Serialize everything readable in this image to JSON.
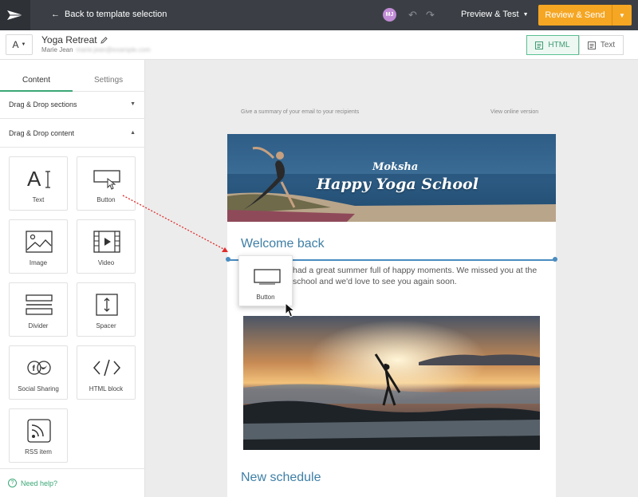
{
  "topbar": {
    "back_label": "Back to template selection",
    "avatar_initials": "MJ",
    "preview_label": "Preview & Test",
    "review_label": "Review & Send"
  },
  "subbar": {
    "font_label": "A",
    "campaign_name": "Yoga Retreat",
    "owner_name": "Marie Jean",
    "owner_email_hidden": "marie.jean@example.com",
    "view_html": "HTML",
    "view_text": "Text"
  },
  "left_panel": {
    "tabs": [
      "Content",
      "Settings"
    ],
    "active_tab": "Content",
    "sections": {
      "dd_sections": "Drag & Drop sections",
      "dd_content": "Drag & Drop content"
    },
    "tiles": [
      {
        "label": "Text",
        "icon": "text-icon"
      },
      {
        "label": "Button",
        "icon": "button-icon"
      },
      {
        "label": "Image",
        "icon": "image-icon"
      },
      {
        "label": "Video",
        "icon": "video-icon"
      },
      {
        "label": "Divider",
        "icon": "divider-icon"
      },
      {
        "label": "Spacer",
        "icon": "spacer-icon"
      },
      {
        "label": "Social Sharing",
        "icon": "social-sharing-icon"
      },
      {
        "label": "HTML block",
        "icon": "code-icon"
      },
      {
        "label": "RSS item",
        "icon": "rss-icon"
      }
    ],
    "help_label": "Need help?"
  },
  "canvas": {
    "summary_text": "Give a summary of your email to your recipients",
    "online_version": "View online version",
    "banner_brand": "Moksha",
    "banner_title": "Happy Yoga School",
    "welcome_heading": "Welcome back",
    "welcome_text": "had a great summer full of happy moments. We missed you at the school and we'd love to see you again soon.",
    "schedule_heading": "New schedule",
    "drag_ghost_label": "Button"
  },
  "colors": {
    "topbar": "#3b3f45",
    "accent_orange": "#f5a623",
    "accent_green": "#3aa776",
    "heading_blue": "#3f7fa6",
    "drag_line": "#4a8cc0",
    "drag_arrow": "#e02b2b"
  }
}
